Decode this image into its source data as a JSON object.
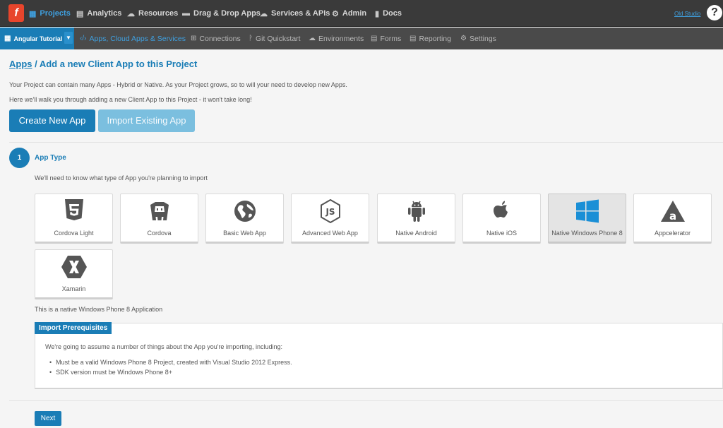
{
  "topbar": {
    "logo_icon": "feedhenry-logo",
    "items": [
      {
        "label": "Projects",
        "icon": "grid-icon"
      },
      {
        "label": "Analytics",
        "icon": "chart-icon"
      },
      {
        "label": "Resources",
        "icon": "cloud-icon"
      },
      {
        "label": "Drag & Drop Apps",
        "icon": "folder-icon"
      },
      {
        "label": "Services & APIs",
        "icon": "cloud-gear-icon"
      },
      {
        "label": "Admin",
        "icon": "cogs-icon"
      },
      {
        "label": "Docs",
        "icon": "book-icon"
      }
    ],
    "old_studio": "Old Studio",
    "help": "?"
  },
  "subbar": {
    "project": "Angular Tutorial",
    "items": [
      {
        "label": "Apps, Cloud Apps & Services",
        "icon": "code-icon"
      },
      {
        "label": "Connections",
        "icon": "connections-icon"
      },
      {
        "label": "Git Quickstart",
        "icon": "git-icon"
      },
      {
        "label": "Environments",
        "icon": "cloud-icon"
      },
      {
        "label": "Forms",
        "icon": "forms-icon"
      },
      {
        "label": "Reporting",
        "icon": "chart-icon"
      },
      {
        "label": "Settings",
        "icon": "cogs-icon"
      }
    ]
  },
  "main": {
    "breadcrumb_link": "Apps",
    "title": " / Add a new Client App to this Project",
    "para1": "Your Project can contain many Apps - Hybrid or Native. As your Project grows, so to will your need to develop new Apps.",
    "para2": "Here we'll walk you through adding a new Client App to this Project - it won't take long!",
    "create_btn": "Create New App",
    "import_btn": "Import Existing App"
  },
  "step": {
    "number": "1",
    "label": "App Type",
    "desc": "We'll need to know what type of App you're planning to import"
  },
  "app_types": [
    {
      "label": "Cordova Light",
      "icon": "html5-icon"
    },
    {
      "label": "Cordova",
      "icon": "cordova-icon"
    },
    {
      "label": "Basic Web App",
      "icon": "globe-icon"
    },
    {
      "label": "Advanced Web App",
      "icon": "nodejs-icon"
    },
    {
      "label": "Native Android",
      "icon": "android-icon"
    },
    {
      "label": "Native iOS",
      "icon": "apple-icon"
    },
    {
      "label": "Native Windows Phone 8",
      "icon": "windows-icon"
    },
    {
      "label": "Appcelerator",
      "icon": "appcelerator-icon"
    },
    {
      "label": "Xamarin",
      "icon": "xamarin-icon"
    }
  ],
  "selected_app_type": "Native Windows Phone 8",
  "app_note": "This is a native Windows Phone 8 Application",
  "prereq": {
    "title": "Import Prerequisites",
    "intro": "We're going to assume a number of things about the App you're importing, including:",
    "bullets": [
      "Must be a valid Windows Phone 8 Project, created with Visual Studio 2012 Express.",
      "SDK version must be Windows Phone 8+"
    ]
  },
  "next_btn": "Next",
  "colors": {
    "accent": "#1a7db6",
    "topbar": "#3a3a3a",
    "subbar": "#4a4a4a",
    "logo": "#e8452c"
  }
}
